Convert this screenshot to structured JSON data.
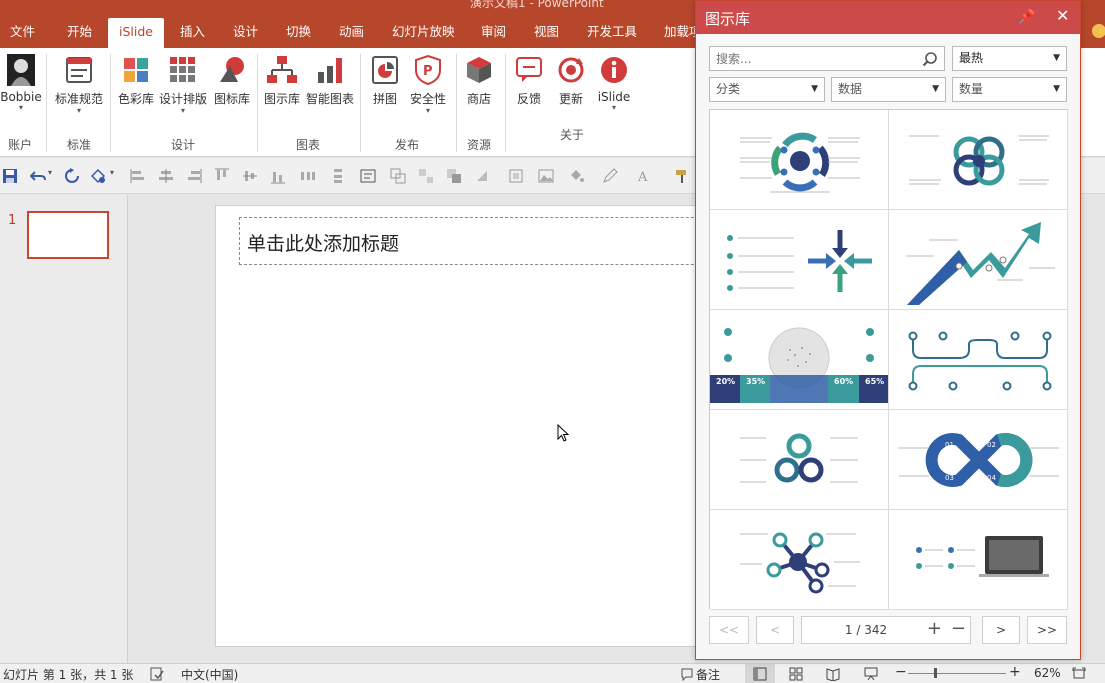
{
  "window": {
    "title": "演示文稿1 - PowerPoint"
  },
  "tabs": [
    "文件",
    "开始",
    "iSlide",
    "插入",
    "设计",
    "切换",
    "动画",
    "幻灯片放映",
    "审阅",
    "视图",
    "开发工具",
    "加载项"
  ],
  "active_tab": "iSlide",
  "ribbon": {
    "buttons": {
      "account": "Bobbie",
      "standard": "标准规范",
      "color_lib": "色彩库",
      "layout": "设计排版",
      "icon_lib": "图标库",
      "diagram_lib": "图示库",
      "smart_chart": "智能图表",
      "puzzle": "拼图",
      "security": "安全性",
      "store": "商店",
      "feedback": "反馈",
      "update": "更新",
      "islide": "iSlide"
    },
    "groups": {
      "account": "账户",
      "standard": "标准",
      "design": "设计",
      "chart": "图表",
      "publish": "发布",
      "resource": "资源",
      "about": "关于"
    }
  },
  "slides": {
    "current_number": "1"
  },
  "slide": {
    "title_placeholder": "单击此处添加标题"
  },
  "status": {
    "slide_info": "幻灯片 第 1 张，共 1 张",
    "language": "中文(中国)",
    "notes": "备注",
    "zoom": "62%"
  },
  "panel": {
    "title": "图示库",
    "search_placeholder": "搜索...",
    "sort": "最热",
    "filters": {
      "category": "分类",
      "data": "数据",
      "quantity": "数量"
    },
    "pagination": {
      "first": "<<",
      "prev": "<",
      "page": "1 / 342",
      "next": ">",
      "last": ">>"
    },
    "diagram_labels": [
      "20%",
      "35%",
      "60%",
      "65%",
      "01",
      "02",
      "03",
      "04"
    ]
  },
  "colors": {
    "accent": "#b7472a",
    "panel_header": "#cc4a4a",
    "teal": "#3a9a9c",
    "navy": "#2f3f77",
    "green": "#3aa37d",
    "blue": "#3a6fb5"
  }
}
